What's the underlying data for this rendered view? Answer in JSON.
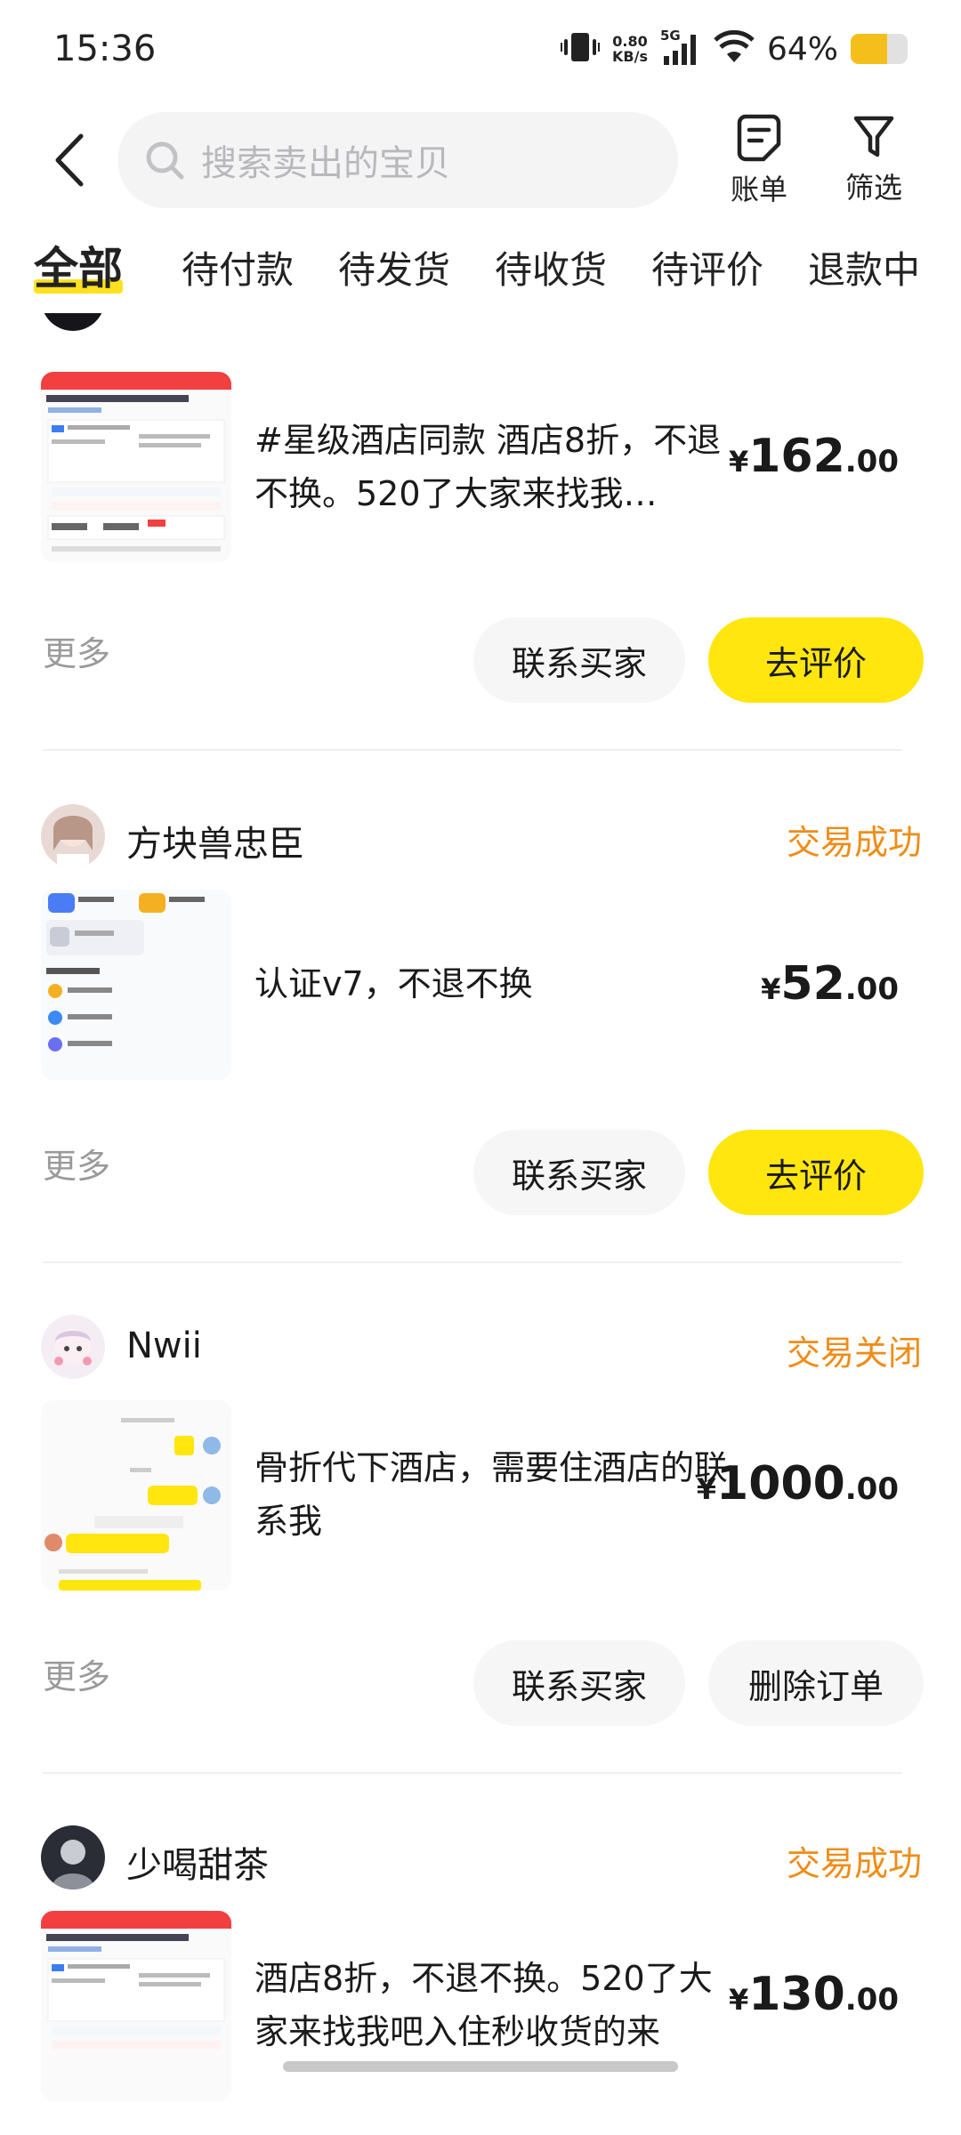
{
  "status_bar": {
    "time": "15:36",
    "net_speed_value": "0.80",
    "net_speed_unit": "KB/s",
    "network": "5G",
    "battery_percent": "64%",
    "battery_level": 0.64,
    "battery_color": "#f5bf1b"
  },
  "header": {
    "search_placeholder": "搜索卖出的宝贝",
    "bill_label": "账单",
    "filter_label": "筛选"
  },
  "tabs": [
    {
      "label": "全部",
      "active": true
    },
    {
      "label": "待付款"
    },
    {
      "label": "待发货"
    },
    {
      "label": "待收货"
    },
    {
      "label": "待评价"
    },
    {
      "label": "退款中"
    }
  ],
  "orders": [
    {
      "title": "#星级酒店同款 酒店8折，不退不换。520了大家来找我…",
      "price_currency": "¥",
      "price_int": "162",
      "price_dec": ".00",
      "more_label": "更多",
      "btn_secondary": "联系买家",
      "btn_primary": "去评价"
    },
    {
      "buyer_name": "方块兽忠臣",
      "status": "交易成功",
      "title": "认证v7，不退不换",
      "price_currency": "¥",
      "price_int": "52",
      "price_dec": ".00",
      "more_label": "更多",
      "btn_secondary": "联系买家",
      "btn_primary": "去评价"
    },
    {
      "buyer_name": "Nwii",
      "status": "交易关闭",
      "title": "骨折代下酒店，需要住酒店的联系我",
      "price_currency": "¥",
      "price_int": "1000",
      "price_dec": ".00",
      "more_label": "更多",
      "btn_secondary": "联系买家",
      "btn_delete": "删除订单"
    },
    {
      "buyer_name": "少喝甜茶",
      "status": "交易成功",
      "title": "酒店8折，不退不换。520了大家来找我吧入住秒收货的来",
      "price_currency": "¥",
      "price_int": "130",
      "price_dec": ".00"
    }
  ],
  "colors": {
    "accent_yellow": "#ffe60f",
    "status_orange": "#f08c16"
  }
}
